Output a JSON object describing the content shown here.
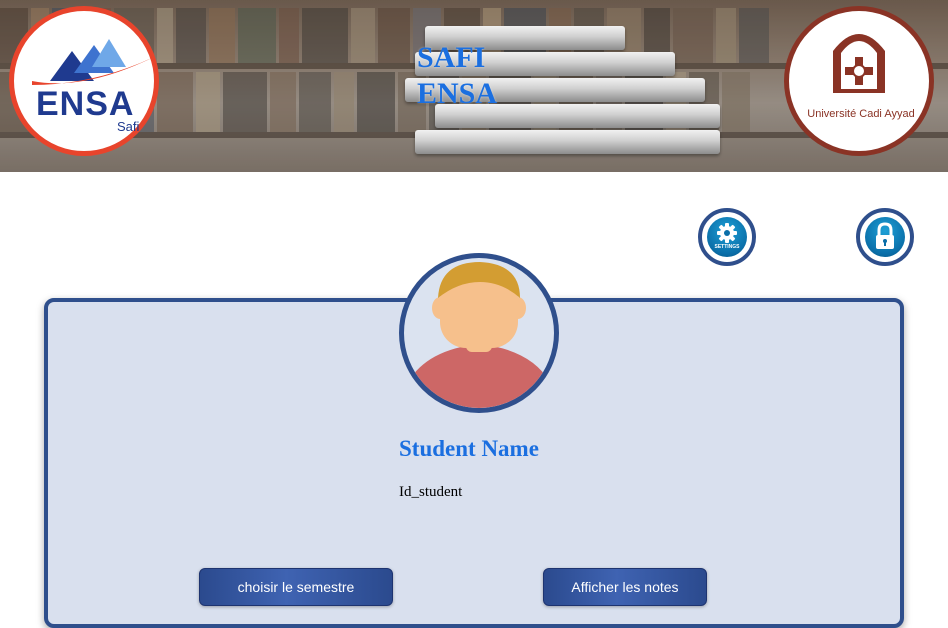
{
  "header": {
    "title_line1": "SAFI",
    "title_line2": "ENSA",
    "left_logo": {
      "name": "ENSA",
      "sub": "Safi"
    },
    "right_logo": {
      "name": "Université Cadi Ayyad"
    }
  },
  "toolbar": {
    "settings_label": "SETTINGS",
    "settings_icon": "gear-icon",
    "lock_icon": "lock-icon"
  },
  "profile": {
    "name": "Student Name",
    "id": "Id_student"
  },
  "actions": {
    "choose_semester": "choisir le semestre",
    "show_grades": "Afficher les notes"
  },
  "colors": {
    "accent": "#1b6fe0",
    "primary": "#2f4f8c",
    "card_bg": "#d9e0ee",
    "ensa_red": "#e8442c",
    "uca_brown": "#8a3325"
  }
}
